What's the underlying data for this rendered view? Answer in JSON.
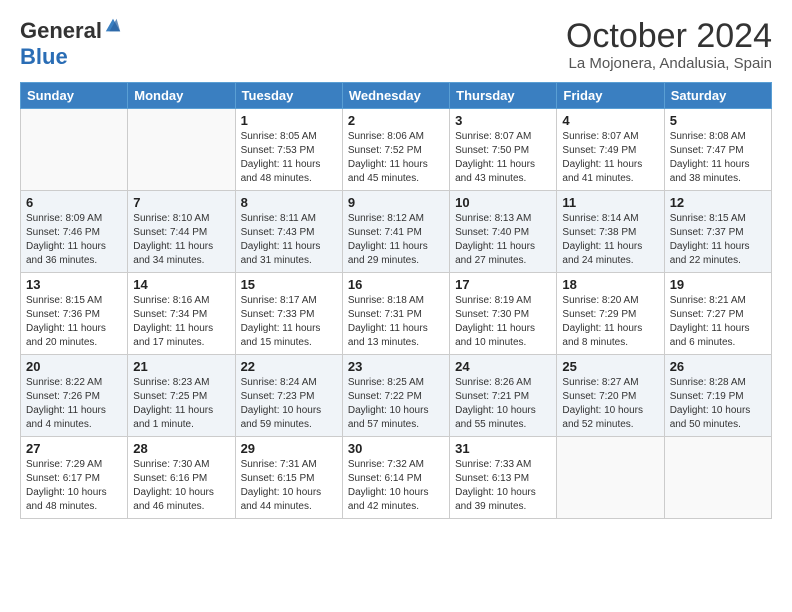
{
  "header": {
    "logo_general": "General",
    "logo_blue": "Blue",
    "month_title": "October 2024",
    "location": "La Mojonera, Andalusia, Spain"
  },
  "days_of_week": [
    "Sunday",
    "Monday",
    "Tuesday",
    "Wednesday",
    "Thursday",
    "Friday",
    "Saturday"
  ],
  "weeks": [
    {
      "shaded": false,
      "days": [
        {
          "num": "",
          "info": ""
        },
        {
          "num": "",
          "info": ""
        },
        {
          "num": "1",
          "info": "Sunrise: 8:05 AM\nSunset: 7:53 PM\nDaylight: 11 hours and 48 minutes."
        },
        {
          "num": "2",
          "info": "Sunrise: 8:06 AM\nSunset: 7:52 PM\nDaylight: 11 hours and 45 minutes."
        },
        {
          "num": "3",
          "info": "Sunrise: 8:07 AM\nSunset: 7:50 PM\nDaylight: 11 hours and 43 minutes."
        },
        {
          "num": "4",
          "info": "Sunrise: 8:07 AM\nSunset: 7:49 PM\nDaylight: 11 hours and 41 minutes."
        },
        {
          "num": "5",
          "info": "Sunrise: 8:08 AM\nSunset: 7:47 PM\nDaylight: 11 hours and 38 minutes."
        }
      ]
    },
    {
      "shaded": true,
      "days": [
        {
          "num": "6",
          "info": "Sunrise: 8:09 AM\nSunset: 7:46 PM\nDaylight: 11 hours and 36 minutes."
        },
        {
          "num": "7",
          "info": "Sunrise: 8:10 AM\nSunset: 7:44 PM\nDaylight: 11 hours and 34 minutes."
        },
        {
          "num": "8",
          "info": "Sunrise: 8:11 AM\nSunset: 7:43 PM\nDaylight: 11 hours and 31 minutes."
        },
        {
          "num": "9",
          "info": "Sunrise: 8:12 AM\nSunset: 7:41 PM\nDaylight: 11 hours and 29 minutes."
        },
        {
          "num": "10",
          "info": "Sunrise: 8:13 AM\nSunset: 7:40 PM\nDaylight: 11 hours and 27 minutes."
        },
        {
          "num": "11",
          "info": "Sunrise: 8:14 AM\nSunset: 7:38 PM\nDaylight: 11 hours and 24 minutes."
        },
        {
          "num": "12",
          "info": "Sunrise: 8:15 AM\nSunset: 7:37 PM\nDaylight: 11 hours and 22 minutes."
        }
      ]
    },
    {
      "shaded": false,
      "days": [
        {
          "num": "13",
          "info": "Sunrise: 8:15 AM\nSunset: 7:36 PM\nDaylight: 11 hours and 20 minutes."
        },
        {
          "num": "14",
          "info": "Sunrise: 8:16 AM\nSunset: 7:34 PM\nDaylight: 11 hours and 17 minutes."
        },
        {
          "num": "15",
          "info": "Sunrise: 8:17 AM\nSunset: 7:33 PM\nDaylight: 11 hours and 15 minutes."
        },
        {
          "num": "16",
          "info": "Sunrise: 8:18 AM\nSunset: 7:31 PM\nDaylight: 11 hours and 13 minutes."
        },
        {
          "num": "17",
          "info": "Sunrise: 8:19 AM\nSunset: 7:30 PM\nDaylight: 11 hours and 10 minutes."
        },
        {
          "num": "18",
          "info": "Sunrise: 8:20 AM\nSunset: 7:29 PM\nDaylight: 11 hours and 8 minutes."
        },
        {
          "num": "19",
          "info": "Sunrise: 8:21 AM\nSunset: 7:27 PM\nDaylight: 11 hours and 6 minutes."
        }
      ]
    },
    {
      "shaded": true,
      "days": [
        {
          "num": "20",
          "info": "Sunrise: 8:22 AM\nSunset: 7:26 PM\nDaylight: 11 hours and 4 minutes."
        },
        {
          "num": "21",
          "info": "Sunrise: 8:23 AM\nSunset: 7:25 PM\nDaylight: 11 hours and 1 minute."
        },
        {
          "num": "22",
          "info": "Sunrise: 8:24 AM\nSunset: 7:23 PM\nDaylight: 10 hours and 59 minutes."
        },
        {
          "num": "23",
          "info": "Sunrise: 8:25 AM\nSunset: 7:22 PM\nDaylight: 10 hours and 57 minutes."
        },
        {
          "num": "24",
          "info": "Sunrise: 8:26 AM\nSunset: 7:21 PM\nDaylight: 10 hours and 55 minutes."
        },
        {
          "num": "25",
          "info": "Sunrise: 8:27 AM\nSunset: 7:20 PM\nDaylight: 10 hours and 52 minutes."
        },
        {
          "num": "26",
          "info": "Sunrise: 8:28 AM\nSunset: 7:19 PM\nDaylight: 10 hours and 50 minutes."
        }
      ]
    },
    {
      "shaded": false,
      "days": [
        {
          "num": "27",
          "info": "Sunrise: 7:29 AM\nSunset: 6:17 PM\nDaylight: 10 hours and 48 minutes."
        },
        {
          "num": "28",
          "info": "Sunrise: 7:30 AM\nSunset: 6:16 PM\nDaylight: 10 hours and 46 minutes."
        },
        {
          "num": "29",
          "info": "Sunrise: 7:31 AM\nSunset: 6:15 PM\nDaylight: 10 hours and 44 minutes."
        },
        {
          "num": "30",
          "info": "Sunrise: 7:32 AM\nSunset: 6:14 PM\nDaylight: 10 hours and 42 minutes."
        },
        {
          "num": "31",
          "info": "Sunrise: 7:33 AM\nSunset: 6:13 PM\nDaylight: 10 hours and 39 minutes."
        },
        {
          "num": "",
          "info": ""
        },
        {
          "num": "",
          "info": ""
        }
      ]
    }
  ]
}
